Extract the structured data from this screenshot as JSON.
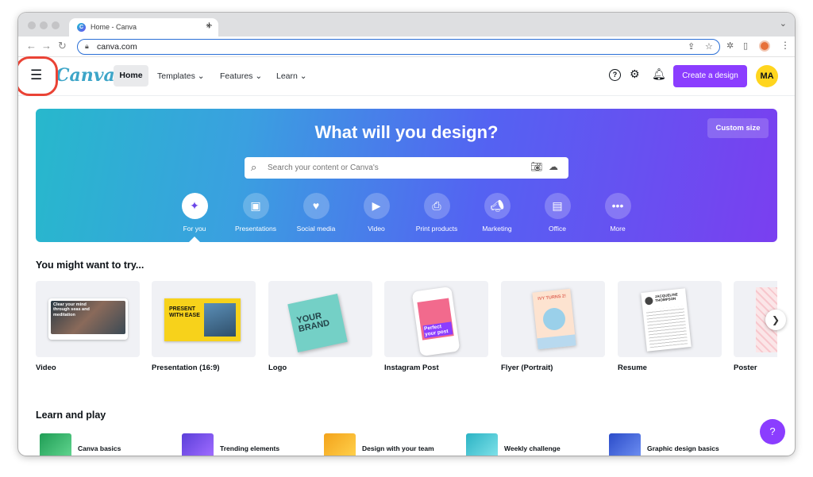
{
  "browser": {
    "tab_title": "Home - Canva",
    "tab_favicon": "C",
    "close_glyph": "×",
    "newtab_glyph": "+",
    "url": "canva.com"
  },
  "nav": {
    "logo": "Canva",
    "home": "Home",
    "templates": "Templates ⌄",
    "features": "Features ⌄",
    "learn": "Learn ⌄",
    "help_glyph": "?",
    "create": "Create a design",
    "avatar": "MA"
  },
  "banner": {
    "title": "What will you design?",
    "custom_size": "Custom size",
    "search_placeholder": "Search your content or Canva's",
    "categories": [
      {
        "label": "For you",
        "icon": "sparkle-icon"
      },
      {
        "label": "Presentations",
        "icon": "presentation-icon"
      },
      {
        "label": "Social media",
        "icon": "heart-icon"
      },
      {
        "label": "Video",
        "icon": "video-icon"
      },
      {
        "label": "Print products",
        "icon": "printer-icon"
      },
      {
        "label": "Marketing",
        "icon": "megaphone-icon"
      },
      {
        "label": "Office",
        "icon": "briefcase-icon"
      },
      {
        "label": "More",
        "icon": "more-icon"
      }
    ]
  },
  "try": {
    "title": "You might want to try...",
    "cards": [
      "Video",
      "Presentation (16:9)",
      "Logo",
      "Instagram Post",
      "Flyer (Portrait)",
      "Resume",
      "Poster"
    ],
    "video_thumb_text": "Clear your mind through seas and meditation",
    "presentation_thumb_text": "PRESENT WITH EASE",
    "logo_thumb_text": "YOUR BRAND",
    "instagram_thumb_text": "Perfect your post",
    "flyer_thumb_text": "IVY TURNS 2!",
    "resume_thumb_text": "JACQUELINE THOMPSON"
  },
  "learn": {
    "title": "Learn and play",
    "items": [
      "Canva basics",
      "Trending elements",
      "Design with your team",
      "Weekly challenge",
      "Graphic design basics"
    ]
  },
  "fab_label": "?",
  "colors": {
    "accent": "#8b3dff",
    "avatar": "#ffd51e",
    "highlight": "#ea4335"
  }
}
